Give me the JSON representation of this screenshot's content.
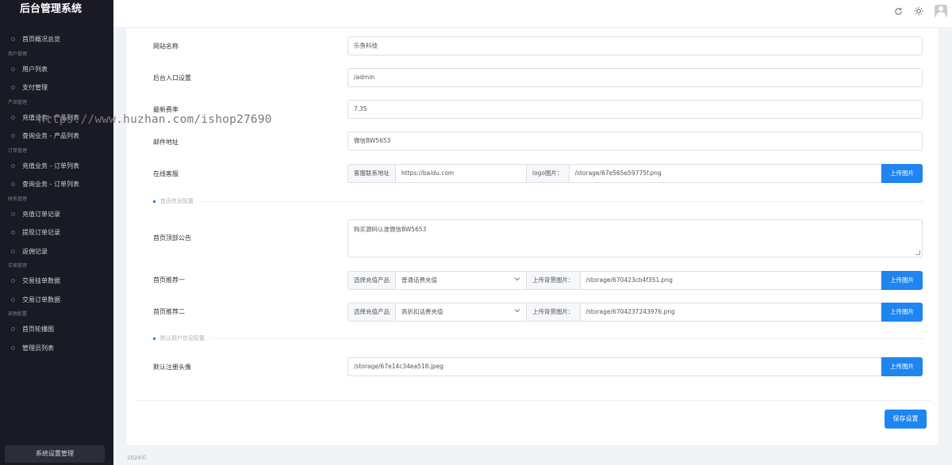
{
  "app": {
    "title": "后台管理系统"
  },
  "sidebar": {
    "items": [
      {
        "type": "item",
        "label": "首页概况总览"
      },
      {
        "type": "group",
        "label": "用户管理"
      },
      {
        "type": "item",
        "label": "用户列表"
      },
      {
        "type": "item",
        "label": "支付管理"
      },
      {
        "type": "group",
        "label": "产品管理"
      },
      {
        "type": "item",
        "label": "充值业务 - 产品列表"
      },
      {
        "type": "item",
        "label": "查询业务 - 产品列表"
      },
      {
        "type": "group",
        "label": "订单管理"
      },
      {
        "type": "item",
        "label": "充值业务 - 订单列表"
      },
      {
        "type": "item",
        "label": "查询业务 - 订单列表"
      },
      {
        "type": "group",
        "label": "财务管理"
      },
      {
        "type": "item",
        "label": "充值订单记录"
      },
      {
        "type": "item",
        "label": "提现订单记录"
      },
      {
        "type": "item",
        "label": "返佣记录"
      },
      {
        "type": "group",
        "label": "交易管理"
      },
      {
        "type": "item",
        "label": "交易挂单数据"
      },
      {
        "type": "item",
        "label": "交易订单数据"
      },
      {
        "type": "group",
        "label": "其他配置"
      },
      {
        "type": "item",
        "label": "首页轮播图"
      },
      {
        "type": "item",
        "label": "管理员列表"
      }
    ],
    "footer": "系统设置管理"
  },
  "topbar": {
    "icons": [
      "refresh-icon",
      "theme-sun-icon",
      "avatar"
    ]
  },
  "form": {
    "site_name": {
      "label": "网站名称",
      "value": "乐鱼科技"
    },
    "admin_entry": {
      "label": "后台入口设置",
      "value": "/admin"
    },
    "rate": {
      "label": "最新费率",
      "value": "7.35"
    },
    "email": {
      "label": "邮件地址",
      "value": "微信BW5653"
    },
    "service": {
      "label": "在线客服",
      "addon1": "客服联系地址",
      "url": "https://baidu.com",
      "addon2": "logo图片：",
      "path": "/storage/67e565e59775f.png",
      "button": "上传图片"
    },
    "section_home": "首页信息配置",
    "notice": {
      "label": "首页顶部公告",
      "value": "购买源码认准微信BW5653"
    },
    "rec1": {
      "label": "首页推荐一",
      "addon1": "选择充值产品",
      "select": "普通话费充值",
      "addon2": "上传背景图片：",
      "path": "/storage/670423cb4f351.png",
      "button": "上传图片"
    },
    "rec2": {
      "label": "首页推荐二",
      "addon1": "选择充值产品",
      "select": "高折扣话费充值",
      "addon2": "上传背景图片：",
      "path": "/storage/6704237243976.png",
      "button": "上传图片"
    },
    "section_user": "默认用户信息配置",
    "avatar": {
      "label": "默认注册头像",
      "path": "/storage/67e14c34ea518.jpeg",
      "button": "上传图片"
    },
    "save": "保存设置"
  },
  "footer": {
    "copyright": "2024©"
  },
  "watermark": "https://www.huzhan.com/ishop27690",
  "colors": {
    "sidebar_bg": "#191a23",
    "primary": "#1e85f1",
    "page_bg": "#f1f3f6"
  }
}
